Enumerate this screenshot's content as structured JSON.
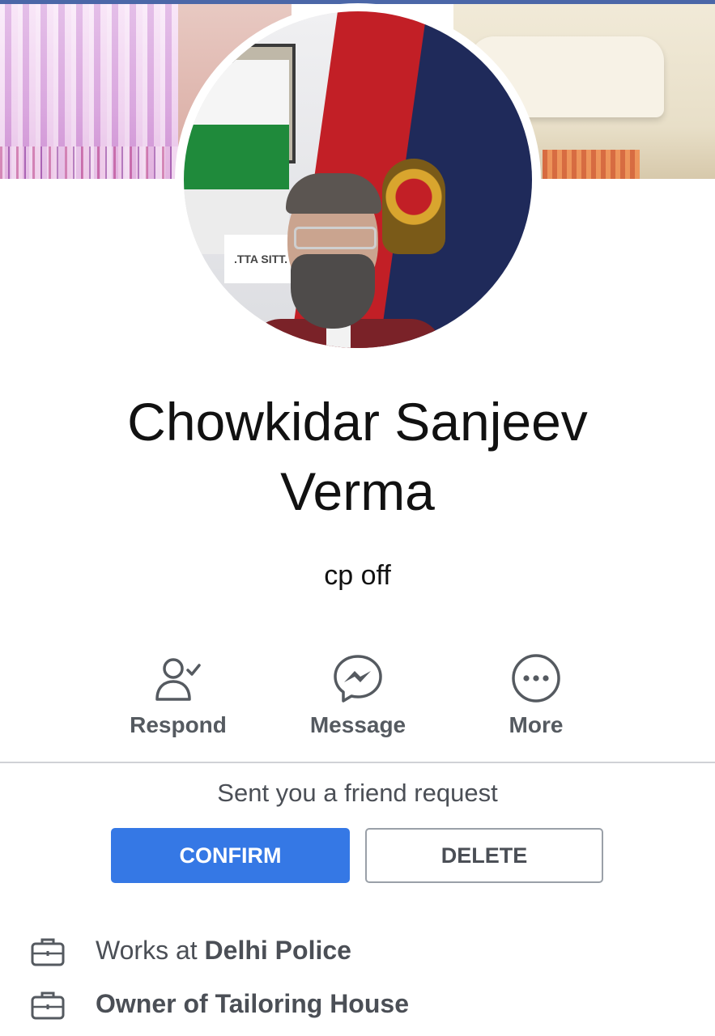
{
  "profile": {
    "name": "Chowkidar Sanjeev Verma",
    "subtitle": "cp off",
    "avatar_sign_text": ".TTA SITT."
  },
  "actions": {
    "respond_label": "Respond",
    "message_label": "Message",
    "more_label": "More"
  },
  "friend_request": {
    "text": "Sent you a friend request",
    "confirm_label": "CONFIRM",
    "delete_label": "DELETE"
  },
  "info": {
    "work_prefix": "Works at ",
    "work_place": "Delhi Police",
    "owner_text": "Owner of Tailoring House"
  },
  "colors": {
    "accent": "#3578e5",
    "header_bar": "#4b67a8",
    "icon_gray": "#555a60",
    "divider": "#d0d2d6"
  },
  "icons": {
    "respond": "person-check-icon",
    "message": "messenger-icon",
    "more": "more-dots-icon",
    "work": "briefcase-icon"
  }
}
